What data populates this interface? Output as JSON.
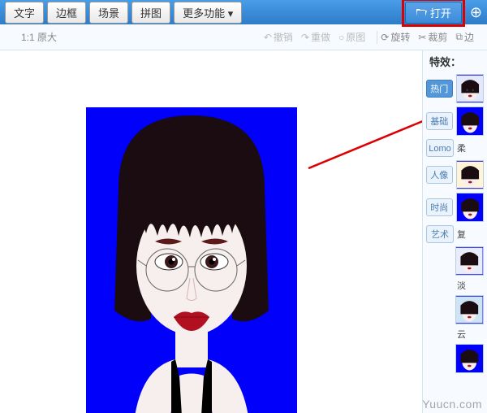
{
  "menu": {
    "items": [
      "文字",
      "边框",
      "场景",
      "拼图",
      "更多功能"
    ]
  },
  "open": {
    "label": "打开"
  },
  "toolbar": {
    "zoom_label": "1:1 原大",
    "undo": "撤销",
    "redo": "重做",
    "original": "原图",
    "rotate": "旋转",
    "crop": "裁剪",
    "bound": "边"
  },
  "side": {
    "title": "特效：",
    "tabs": [
      "热门",
      "基础",
      "Lomo",
      "人像",
      "时尚",
      "艺术"
    ],
    "presets": [
      "",
      "柔",
      "复",
      "淡",
      "云"
    ]
  },
  "watermark": "Yuucn.com"
}
